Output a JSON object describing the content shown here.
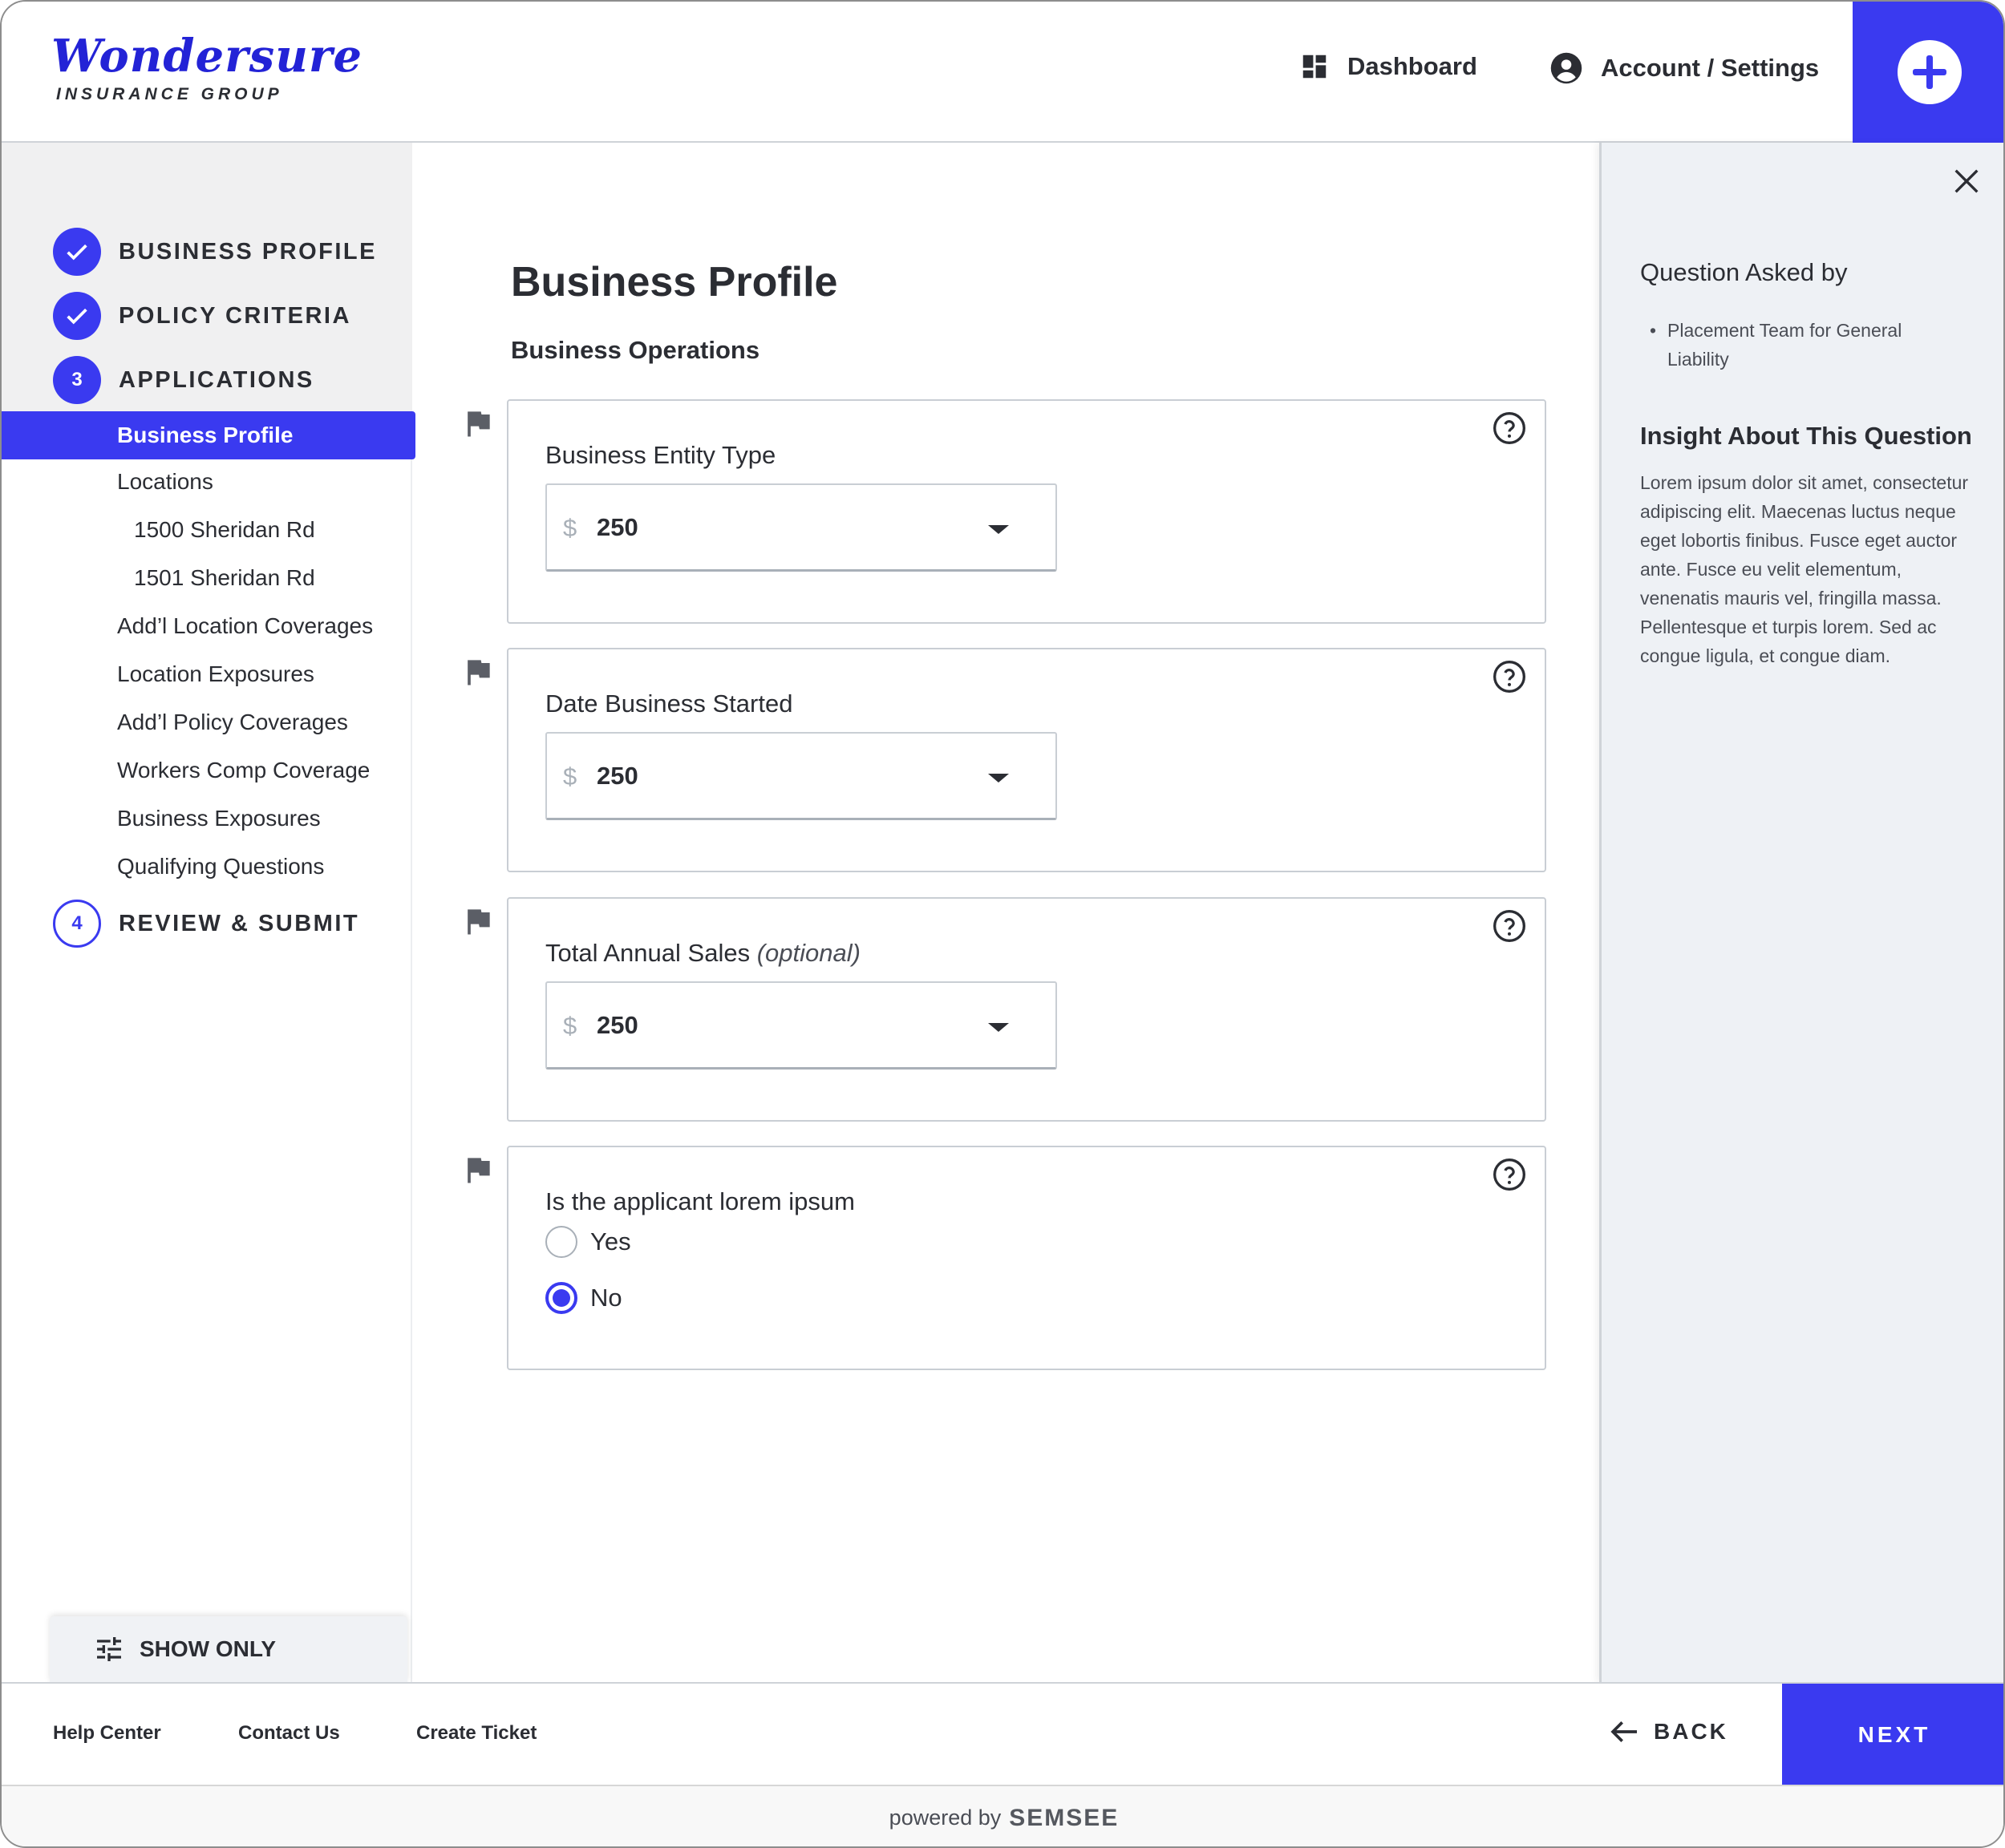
{
  "brand": {
    "name": "Wondersure",
    "subtitle": "INSURANCE GROUP"
  },
  "header": {
    "dashboard_label": "Dashboard",
    "account_label": "Account / Settings",
    "accent": "#3a3af0"
  },
  "sidebar": {
    "steps": [
      {
        "num": "",
        "label": "BUSINESS PROFILE",
        "state": "done"
      },
      {
        "num": "",
        "label": "POLICY CRITERIA",
        "state": "done"
      },
      {
        "num": "3",
        "label": "APPLICATIONS",
        "state": "current"
      },
      {
        "num": "4",
        "label": "REVIEW & SUBMIT",
        "state": "todo"
      }
    ],
    "items": [
      "Business Profile",
      "Locations",
      "1500 Sheridan Rd",
      "1501 Sheridan Rd",
      "Add’l Location Coverages",
      "Location Exposures",
      "Add’l Policy Coverages",
      "Workers Comp Coverage",
      "Business Exposures",
      "Qualifying Questions"
    ],
    "active_item": "Business Profile",
    "show_only_label": "SHOW ONLY"
  },
  "main": {
    "title": "Business Profile",
    "section": "Business Operations",
    "questions": [
      {
        "label": "Business Entity Type",
        "optional": "",
        "currency": "$",
        "value": "250"
      },
      {
        "label": "Date Business Started",
        "optional": "",
        "currency": "$",
        "value": "250"
      },
      {
        "label": "Total Annual Sales",
        "optional": "(optional)",
        "currency": "$",
        "value": "250"
      },
      {
        "label": "Is the applicant lorem ipsum",
        "options": [
          "Yes",
          "No"
        ],
        "selected": "No"
      }
    ]
  },
  "right_panel": {
    "asked_by_title": "Question Asked by",
    "asked_by": "Placement Team for General Liability",
    "insight_title": "Insight About This Question",
    "insight_body": "Lorem ipsum dolor sit amet, consectetur adipiscing elit. Maecenas luctus neque eget lobortis finibus. Fusce eget auctor ante. Fusce eu velit elementum, venenatis mauris vel, fringilla massa. Pellentesque et turpis lorem. Sed ac congue ligula, et congue diam."
  },
  "footer": {
    "links": [
      "Help Center",
      "Contact Us",
      "Create Ticket"
    ],
    "back_label": "BACK",
    "next_label": "NEXT",
    "powered_by": "powered by",
    "powered_brand": "SEMSEE"
  }
}
